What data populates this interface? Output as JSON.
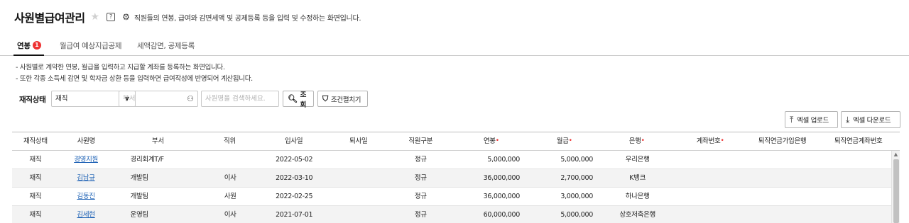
{
  "header": {
    "title": "사원별급여관리",
    "help_icon_label": "?",
    "description": "직원들의 연봉, 급여와 감면세액 및 공제등록 등을 입력 및 수정하는 화면입니다."
  },
  "tabs": [
    {
      "label": "연봉",
      "badge": "1",
      "active": true
    },
    {
      "label": "월급여 예상지급공제",
      "active": false
    },
    {
      "label": "세액감면, 공제등록",
      "active": false
    }
  ],
  "notes": [
    "- 사원별로 계약한 연봉, 월급을 입력하고 지급할 계좌를 등록하는 화면입니다.",
    "- 또한 각종 소득세 감면 및 학자금 상환 등을 입력하면 급여작성에 반영되어 계산됩니다."
  ],
  "filters": {
    "status_label": "재직상태",
    "status_value": "재직",
    "dept_placeholder": "부서",
    "name_placeholder": "사원명을 검색하세요.",
    "search_button": "조회",
    "condition_button": "조건펼치기"
  },
  "toolbar": {
    "excel_upload": "엑셀 업로드",
    "excel_download": "엑셀 다운로드"
  },
  "table": {
    "columns": {
      "status": "재직상태",
      "name": "사원명",
      "dept": "부서",
      "position": "직위",
      "join_date": "입사일",
      "leave_date": "퇴사일",
      "emp_type": "직원구분",
      "annual": "연봉",
      "monthly": "월급",
      "bank": "은행",
      "account": "계좌번호",
      "pension": "퇴직연금가입은행",
      "pension_account": "퇴직연금계좌번호"
    },
    "required_mark": "•",
    "rows": [
      {
        "status": "재직",
        "name": "경영지원",
        "dept": "경리회계T/F",
        "position": "",
        "join_date": "2022-05-02",
        "leave_date": "",
        "emp_type": "정규",
        "annual": "5,000,000",
        "monthly": "5,000,000",
        "bank": "우리은행",
        "account": "",
        "pension": "",
        "pension_account": ""
      },
      {
        "status": "재직",
        "name": "김남규",
        "dept": "개발팀",
        "position": "이사",
        "join_date": "2022-03-10",
        "leave_date": "",
        "emp_type": "정규",
        "annual": "36,000,000",
        "monthly": "2,700,000",
        "bank": "K뱅크",
        "account": "",
        "pension": "",
        "pension_account": ""
      },
      {
        "status": "재직",
        "name": "김동진",
        "dept": "개발팀",
        "position": "사원",
        "join_date": "2022-02-25",
        "leave_date": "",
        "emp_type": "정규",
        "annual": "36,000,000",
        "monthly": "3,000,000",
        "bank": "하나은행",
        "account": "",
        "pension": "",
        "pension_account": ""
      },
      {
        "status": "재직",
        "name": "김세현",
        "dept": "운영팀",
        "position": "이사",
        "join_date": "2021-07-01",
        "leave_date": "",
        "emp_type": "정규",
        "annual": "60,000,000",
        "monthly": "5,000,000",
        "bank": "상호저축은행",
        "account": "",
        "pension": "",
        "pension_account": ""
      }
    ]
  },
  "colors": {
    "accent_red": "#e33333",
    "link_blue": "#1a5fb4"
  },
  "icons": {
    "favorite": "star-icon",
    "help": "help-icon",
    "settings": "gear-icon",
    "dropdown": "caret-down-icon",
    "org_chart": "org-chart-icon",
    "search": "search-icon",
    "filter": "filter-icon",
    "upload": "upload-icon",
    "download": "download-icon"
  }
}
